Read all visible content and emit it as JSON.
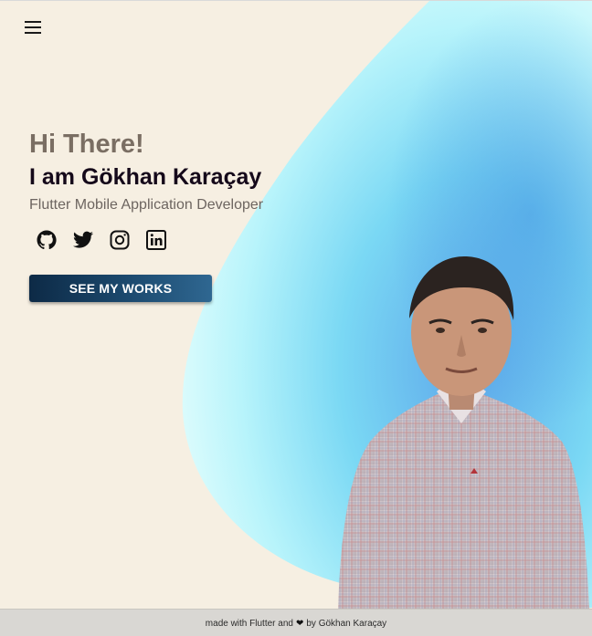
{
  "header": {
    "menu_icon": "hamburger-menu-icon"
  },
  "hero": {
    "greeting": "Hi There!",
    "name": "I am Gökhan Karaçay",
    "role": "Flutter Mobile Application Developer",
    "socials": [
      {
        "name": "GitHub",
        "icon": "github-icon"
      },
      {
        "name": "Twitter",
        "icon": "twitter-icon"
      },
      {
        "name": "Instagram",
        "icon": "instagram-icon"
      },
      {
        "name": "LinkedIn",
        "icon": "linkedin-icon"
      }
    ],
    "cta_label": "SEE MY WORKS"
  },
  "footer": {
    "prefix": "made with Flutter and",
    "heart": "❤",
    "suffix": "by Gökhan Karaçay"
  },
  "colors": {
    "background": "#f6efe2",
    "blob_light": "#b8f4fb",
    "blob_dark": "#3f8fe0",
    "cta_dark": "#0d2a46",
    "cta_light": "#2f6791",
    "footer": "#d9d7d3"
  }
}
